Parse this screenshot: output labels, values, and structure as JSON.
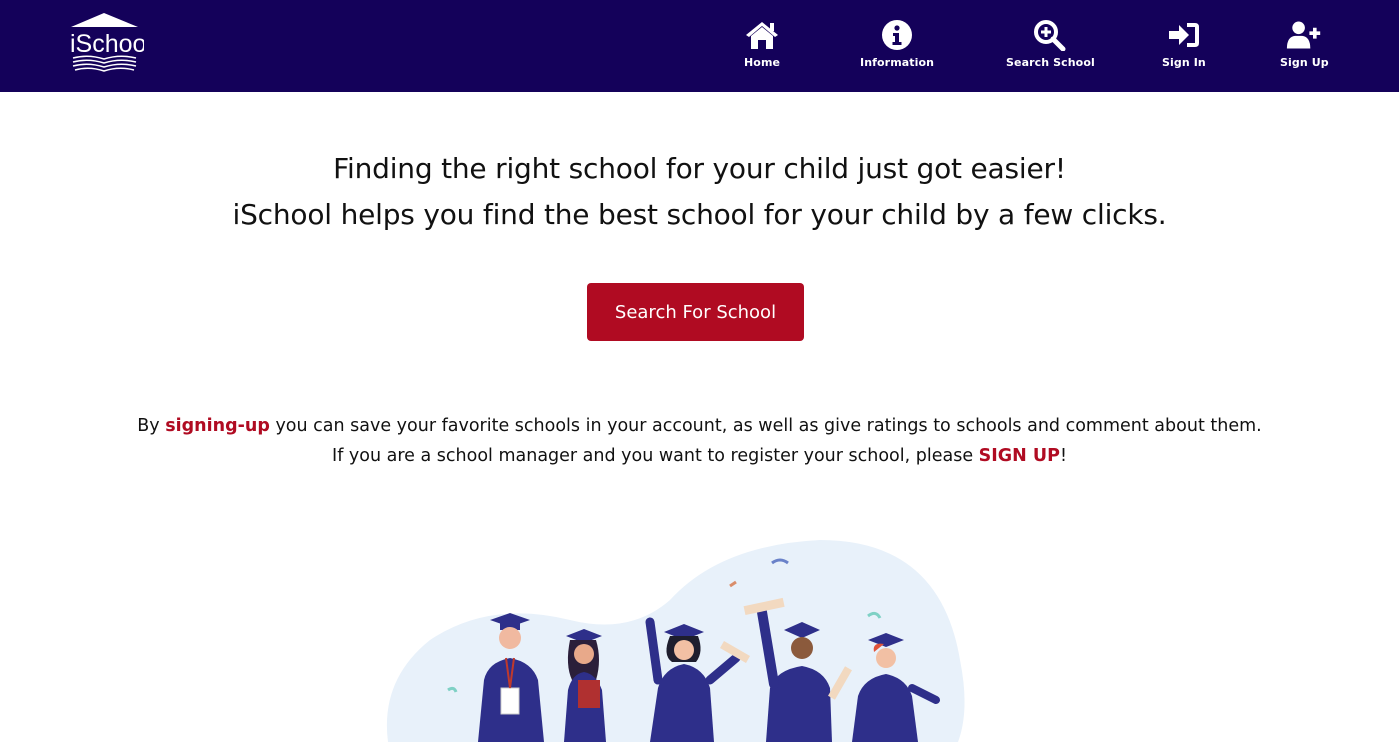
{
  "navbar": {
    "logo_text": "iSchool",
    "items": [
      {
        "label": "Home",
        "icon": "home-icon"
      },
      {
        "label": "Information",
        "icon": "info-icon"
      },
      {
        "label": "Search School",
        "icon": "search-plus-icon"
      },
      {
        "label": "Sign In",
        "icon": "sign-in-icon"
      },
      {
        "label": "Sign Up",
        "icon": "user-plus-icon"
      }
    ]
  },
  "hero": {
    "line1": "Finding the right school for your child just got easier!",
    "line2": "iSchool helps you find the best school for your child by a few clicks.",
    "cta_label": "Search For School"
  },
  "info": {
    "line1_prefix": "By ",
    "line1_link": "signing-up",
    "line1_suffix": " you can save your favorite schools in your account, as well as give ratings to schools and comment about them.",
    "line2_prefix": "If you are a school manager and you want to register your school, please ",
    "line2_link": "SIGN UP",
    "line2_suffix": "!"
  },
  "colors": {
    "navbar_bg": "#14015a",
    "accent": "#b00b22",
    "gown": "#2e2f8a"
  }
}
